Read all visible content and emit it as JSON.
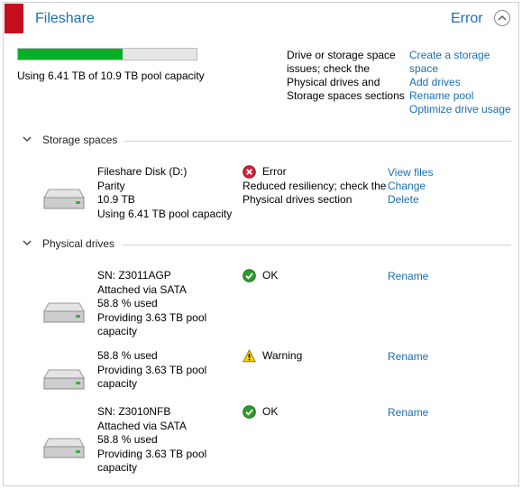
{
  "pool": {
    "title": "Fileshare",
    "status": "Error",
    "capacity_text": "Using 6.41 TB of 10.9 TB pool capacity",
    "usage_fraction": 0.588,
    "message": "Drive or storage space issues; check the Physical drives and Storage spaces sections",
    "links": [
      "Create a storage space",
      "Add drives",
      "Rename pool",
      "Optimize drive usage"
    ]
  },
  "storage_spaces": {
    "heading": "Storage spaces",
    "items": [
      {
        "name": "Fileshare Disk (D:)",
        "resiliency": "Parity",
        "size": "10.9 TB",
        "usage": "Using 6.41 TB pool capacity",
        "status": "Error",
        "status_icon": "error-icon",
        "status_detail": "Reduced resiliency; check the Physical drives section",
        "actions": [
          "View files",
          "Change",
          "Delete"
        ]
      }
    ]
  },
  "physical_drives": {
    "heading": "Physical drives",
    "items": [
      {
        "lines": [
          "SN: Z3011AGP",
          "Attached via SATA",
          "58.8 % used",
          "Providing 3.63 TB pool capacity"
        ],
        "status": "OK",
        "status_icon": "ok-icon",
        "action": "Rename"
      },
      {
        "lines": [
          "58.8 % used",
          "Providing 3.63 TB pool capacity"
        ],
        "status": "Warning",
        "status_icon": "warning-icon",
        "action": "Rename"
      },
      {
        "lines": [
          "SN: Z3010NFB",
          "Attached via SATA",
          "58.8 % used",
          "Providing 3.63 TB pool capacity"
        ],
        "status": "OK",
        "status_icon": "ok-icon",
        "action": "Rename"
      }
    ]
  },
  "colors": {
    "accent_link": "#1a6fb0",
    "error_red": "#c50f1f",
    "progress_green": "#06b025",
    "ok_green": "#107c10",
    "warning_yellow": "#fcd116"
  }
}
